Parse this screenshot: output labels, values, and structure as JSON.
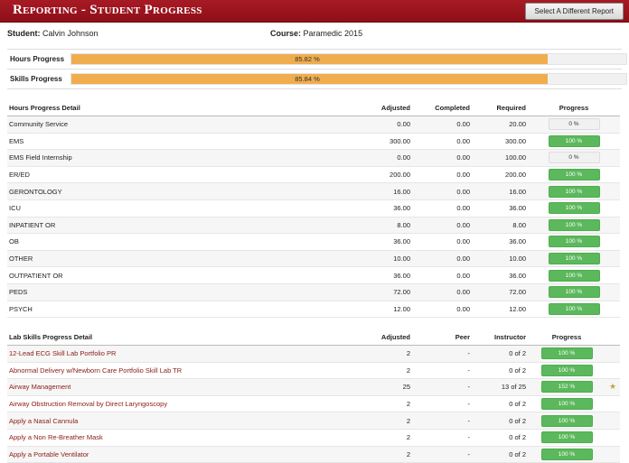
{
  "header": {
    "title": "Reporting - Student Progress",
    "button_label": "Select A Different Report"
  },
  "info": {
    "student_label": "Student:",
    "student_name": "Calvin Johnson",
    "course_label": "Course:",
    "course_name": "Paramedic 2015"
  },
  "progress": [
    {
      "label": "Hours Progress",
      "value_text": "85.82 %",
      "percent": 85.82
    },
    {
      "label": "Skills Progress",
      "value_text": "85.84 %",
      "percent": 85.84
    }
  ],
  "hours": {
    "headers": {
      "name": "Hours Progress Detail",
      "adjusted": "Adjusted",
      "completed": "Completed",
      "required": "Required",
      "progress": "Progress"
    },
    "rows": [
      {
        "name": "Community Service",
        "adjusted": "0.00",
        "completed": "0.00",
        "required": "20.00",
        "progress": "0 %"
      },
      {
        "name": "EMS",
        "adjusted": "300.00",
        "completed": "0.00",
        "required": "300.00",
        "progress": "100 %"
      },
      {
        "name": "EMS Field Internship",
        "adjusted": "0.00",
        "completed": "0.00",
        "required": "100.00",
        "progress": "0 %"
      },
      {
        "name": "ER/ED",
        "adjusted": "200.00",
        "completed": "0.00",
        "required": "200.00",
        "progress": "100 %"
      },
      {
        "name": "GERONTOLOGY",
        "adjusted": "16.00",
        "completed": "0.00",
        "required": "16.00",
        "progress": "100 %"
      },
      {
        "name": "ICU",
        "adjusted": "36.00",
        "completed": "0.00",
        "required": "36.00",
        "progress": "100 %"
      },
      {
        "name": "INPATIENT OR",
        "adjusted": "8.00",
        "completed": "0.00",
        "required": "8.00",
        "progress": "100 %"
      },
      {
        "name": "OB",
        "adjusted": "36.00",
        "completed": "0.00",
        "required": "36.00",
        "progress": "100 %"
      },
      {
        "name": "OTHER",
        "adjusted": "10.00",
        "completed": "0.00",
        "required": "10.00",
        "progress": "100 %"
      },
      {
        "name": "OUTPATIENT OR",
        "adjusted": "36.00",
        "completed": "0.00",
        "required": "36.00",
        "progress": "100 %"
      },
      {
        "name": "PEDS",
        "adjusted": "72.00",
        "completed": "0.00",
        "required": "72.00",
        "progress": "100 %"
      },
      {
        "name": "PSYCH",
        "adjusted": "12.00",
        "completed": "0.00",
        "required": "12.00",
        "progress": "100 %"
      }
    ]
  },
  "skills": {
    "headers": {
      "name": "Lab Skills Progress Detail",
      "adjusted": "Adjusted",
      "peer": "Peer",
      "instructor": "Instructor",
      "progress": "Progress"
    },
    "rows": [
      {
        "name": "12-Lead ECG Skill Lab Portfolio PR",
        "adjusted": "2",
        "peer": "-",
        "instructor": "0 of 2",
        "progress": "100 %",
        "star": ""
      },
      {
        "name": "Abnormal Delivery w/Newborn Care Portfolio Skill Lab TR",
        "adjusted": "2",
        "peer": "-",
        "instructor": "0 of 2",
        "progress": "100 %",
        "star": ""
      },
      {
        "name": "Airway Management",
        "adjusted": "25",
        "peer": "-",
        "instructor": "13 of 25",
        "progress": "152 %",
        "star": "★"
      },
      {
        "name": "Airway Obstruction Removal by Direct Laryngoscopy",
        "adjusted": "2",
        "peer": "-",
        "instructor": "0 of 2",
        "progress": "100 %",
        "star": ""
      },
      {
        "name": "Apply a Nasal Cannula",
        "adjusted": "2",
        "peer": "-",
        "instructor": "0 of 2",
        "progress": "100 %",
        "star": ""
      },
      {
        "name": "Apply a Non Re-Breather Mask",
        "adjusted": "2",
        "peer": "-",
        "instructor": "0 of 2",
        "progress": "100 %",
        "star": ""
      },
      {
        "name": "Apply a Portable Ventilator",
        "adjusted": "2",
        "peer": "-",
        "instructor": "0 of 2",
        "progress": "100 %",
        "star": ""
      }
    ]
  }
}
